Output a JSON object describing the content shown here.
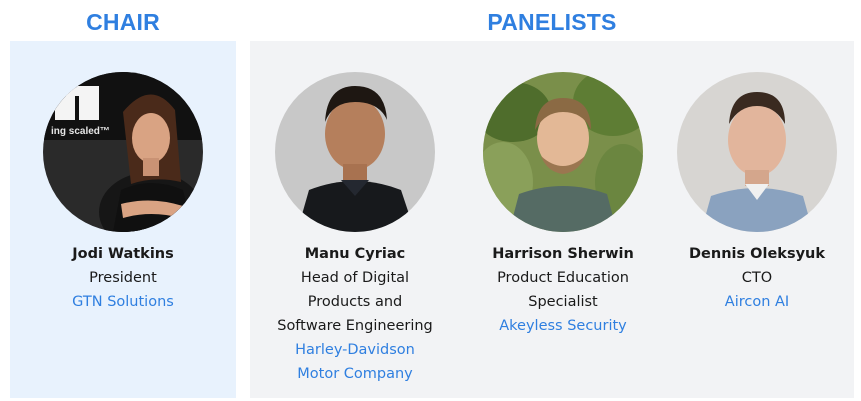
{
  "sections": {
    "chair_heading": "CHAIR",
    "panelists_heading": "PANELISTS"
  },
  "chair": {
    "name": "Jodi Watkins",
    "title": [
      "President"
    ],
    "org": [
      "GTN Solutions"
    ],
    "backdrop_text": "ing scaled™"
  },
  "panelists": [
    {
      "name": "Manu Cyriac",
      "title": [
        "Head of Digital",
        "Products and",
        "Software Engineering"
      ],
      "org": [
        "Harley-Davidson",
        "Motor Company"
      ]
    },
    {
      "name": "Harrison Sherwin",
      "title": [
        "Product Education",
        "Specialist"
      ],
      "org": [
        "Akeyless Security"
      ]
    },
    {
      "name": "Dennis Oleksyuk",
      "title": [
        "CTO"
      ],
      "org": [
        "Aircon AI"
      ]
    }
  ],
  "colors": {
    "accent": "#2f7fe0",
    "chair_bg": "#e8f2fd",
    "panel_bg": "#f2f3f5"
  }
}
